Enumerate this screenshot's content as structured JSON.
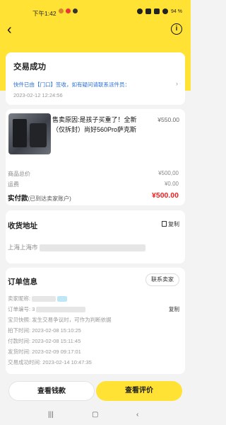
{
  "status_bar": {
    "time": "下午1:42",
    "battery": "94 %"
  },
  "nav": {
    "back": "‹",
    "info": "i"
  },
  "order_status": {
    "title": "交易成功",
    "message": "快件已由【门口】签收，如有疑问请联系派件员：",
    "arrow": "›",
    "time": "2023-02-12 12:24:56"
  },
  "goods": {
    "title": "售卖原因:是孩子买重了！全新（仅拆封）尚好560Pro萨克斯",
    "price": "¥550.00"
  },
  "summary": {
    "total_label": "商品总价",
    "total_value": "¥500,00",
    "shipping_label": "运费",
    "shipping_value": "¥0.00",
    "paid_label": "实付款",
    "paid_sub": "(已到达卖家账户)",
    "paid_value": "¥500.00"
  },
  "address": {
    "title": "收货地址",
    "copy": "复制",
    "line": "上海上海市"
  },
  "order_info": {
    "title": "订单信息",
    "contact": "联系卖家",
    "seller_label": "卖家昵称:",
    "order_no_label": "订单编号: 3",
    "copy": "复制",
    "guarantee": "宝贝快照: 发生交易争议时，可作为判断依据",
    "placed": "拍下时间: 2023-02-08 15:10:25",
    "paid": "付款时间: 2023-02-08 15:11:45",
    "shipped": "发货时间: 2023-02-09 09:17:01",
    "completed": "交易成功时间: 2023-02-14 10:47:35"
  },
  "actions": {
    "view_money": "查看钱款",
    "view_review": "查看评价"
  },
  "system_nav": {
    "recents": "|||",
    "home": "▢",
    "back": "‹"
  }
}
